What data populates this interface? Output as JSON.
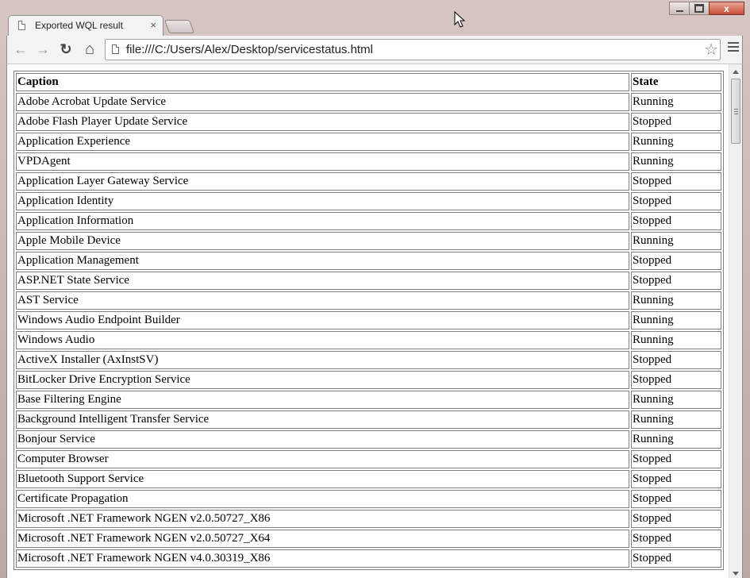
{
  "window": {
    "minimize_label": "",
    "maximize_label": "",
    "close_label": "x"
  },
  "tab": {
    "title": "Exported WQL result",
    "close": "×"
  },
  "toolbar": {
    "back": "←",
    "forward": "→",
    "reload": "↻",
    "home": "⌂",
    "url": "file:///C:/Users/Alex/Desktop/servicestatus.html",
    "bookmark_star": "☆"
  },
  "table": {
    "headers": [
      "Caption",
      "State"
    ],
    "rows": [
      [
        "Adobe Acrobat Update Service",
        "Running"
      ],
      [
        "Adobe Flash Player Update Service",
        "Stopped"
      ],
      [
        "Application Experience",
        "Running"
      ],
      [
        "VPDAgent",
        "Running"
      ],
      [
        "Application Layer Gateway Service",
        "Stopped"
      ],
      [
        "Application Identity",
        "Stopped"
      ],
      [
        "Application Information",
        "Stopped"
      ],
      [
        "Apple Mobile Device",
        "Running"
      ],
      [
        "Application Management",
        "Stopped"
      ],
      [
        "ASP.NET State Service",
        "Stopped"
      ],
      [
        "AST Service",
        "Running"
      ],
      [
        "Windows Audio Endpoint Builder",
        "Running"
      ],
      [
        "Windows Audio",
        "Running"
      ],
      [
        "ActiveX Installer (AxInstSV)",
        "Stopped"
      ],
      [
        "BitLocker Drive Encryption Service",
        "Stopped"
      ],
      [
        "Base Filtering Engine",
        "Running"
      ],
      [
        "Background Intelligent Transfer Service",
        "Running"
      ],
      [
        "Bonjour Service",
        "Running"
      ],
      [
        "Computer Browser",
        "Stopped"
      ],
      [
        "Bluetooth Support Service",
        "Stopped"
      ],
      [
        "Certificate Propagation",
        "Stopped"
      ],
      [
        "Microsoft .NET Framework NGEN v2.0.50727_X86",
        "Stopped"
      ],
      [
        "Microsoft .NET Framework NGEN v2.0.50727_X64",
        "Stopped"
      ],
      [
        "Microsoft .NET Framework NGEN v4.0.30319_X86",
        "Stopped"
      ]
    ]
  }
}
